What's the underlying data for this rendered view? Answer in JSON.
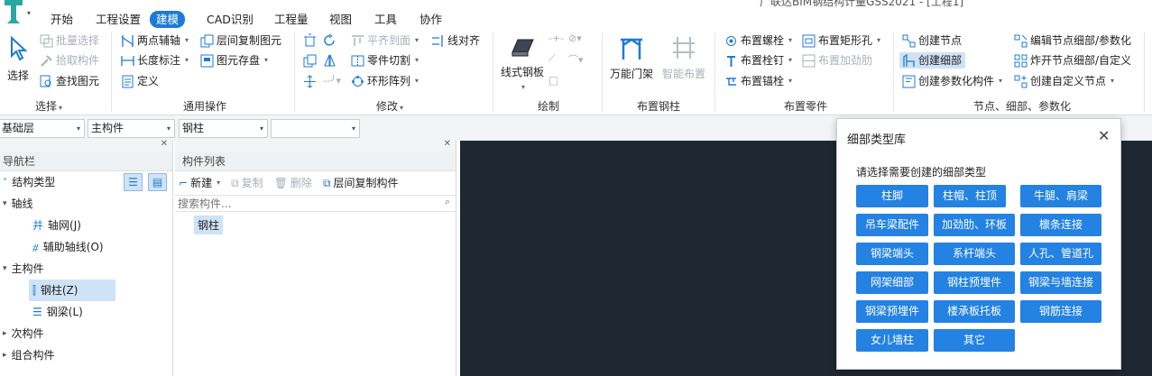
{
  "app": {
    "title_fragment": "广联达BIM钢结构计量GSS2021 - [工程1]"
  },
  "tabs": [
    {
      "label": "开始"
    },
    {
      "label": "工程设置"
    },
    {
      "label": "建模"
    },
    {
      "label": "CAD识别"
    },
    {
      "label": "工程量"
    },
    {
      "label": "视图"
    },
    {
      "label": "工具"
    },
    {
      "label": "协作"
    }
  ],
  "ribbon": {
    "select": {
      "select_btn": "选择",
      "batch_select": "批量选择",
      "pick_component": "拾取构件",
      "find_element": "查找图元",
      "label": "选择"
    },
    "common": {
      "two_point_axis": "两点辅轴",
      "floor_copy_element": "层间复制图元",
      "length_dim": "长度标注",
      "element_save": "图元存盘",
      "define": "定义",
      "label": "通用操作"
    },
    "modify": {
      "align_top": "平齐到面",
      "line_align": "线对齐",
      "part_cut": "零件切割",
      "ring_array": "环形阵列",
      "label": "修改"
    },
    "draw": {
      "line_steel_plate": "线式钢板",
      "label": "绘制"
    },
    "place_steel": {
      "universal_portal": "万能门架",
      "smart_place": "智能布置",
      "label": "布置钢柱"
    },
    "parts": {
      "place_bolt": "布置螺栓",
      "place_rect_hole": "布置矩形孔",
      "place_stud": "布置栓钉",
      "place_stiffener": "布置加劲肋",
      "place_anchor": "布置锚栓",
      "label": "布置零件"
    },
    "nodes": {
      "create_node": "创建节点",
      "edit_node_detail": "编辑节点细部/参数化",
      "create_detail": "创建细部",
      "explode_node": "炸开节点细部/自定义",
      "create_param_component": "创建参数化构件",
      "create_custom_node": "创建自定义节点",
      "label": "节点、细部、参数化"
    }
  },
  "selectors": {
    "floor": "基础层",
    "category": "主构件",
    "type": "钢柱",
    "extra": ""
  },
  "nav": {
    "title": "导航栏",
    "structure_type": "结构类型",
    "tree": [
      {
        "label": "轴线"
      },
      {
        "label": "轴网(J)"
      },
      {
        "label": "辅助轴线(O)"
      },
      {
        "label": "主构件"
      },
      {
        "label": "钢柱(Z)"
      },
      {
        "label": "钢梁(L)"
      },
      {
        "label": "次构件"
      },
      {
        "label": "组合构件"
      }
    ]
  },
  "component_list": {
    "title": "构件列表",
    "new": "新建",
    "copy": "复制",
    "delete": "删除",
    "floor_copy": "层间复制构件",
    "search_placeholder": "搜索构件...",
    "items": [
      {
        "label": "钢柱"
      }
    ]
  },
  "dialog": {
    "title": "细部类型库",
    "prompt": "请选择需要创建的细部类型",
    "buttons": [
      {
        "label": "柱脚"
      },
      {
        "label": "柱帽、柱顶"
      },
      {
        "label": "牛腿、肩梁"
      },
      {
        "label": "吊车梁配件"
      },
      {
        "label": "加劲肋、环板"
      },
      {
        "label": "檩条连接"
      },
      {
        "label": "钢梁端头"
      },
      {
        "label": "系杆端头"
      },
      {
        "label": "人孔、管道孔"
      },
      {
        "label": "网架细部"
      },
      {
        "label": "钢柱预埋件"
      },
      {
        "label": "钢梁与墙连接"
      },
      {
        "label": "钢梁预埋件"
      },
      {
        "label": "楼承板托板"
      },
      {
        "label": "钢筋连接"
      },
      {
        "label": "女儿墙柱"
      },
      {
        "label": "其它"
      }
    ]
  },
  "colors": {
    "accent": "#1c7bd6",
    "dialog_button": "#2382e2",
    "canvas": "#1f2733",
    "selected_row": "#cfe3f7"
  }
}
